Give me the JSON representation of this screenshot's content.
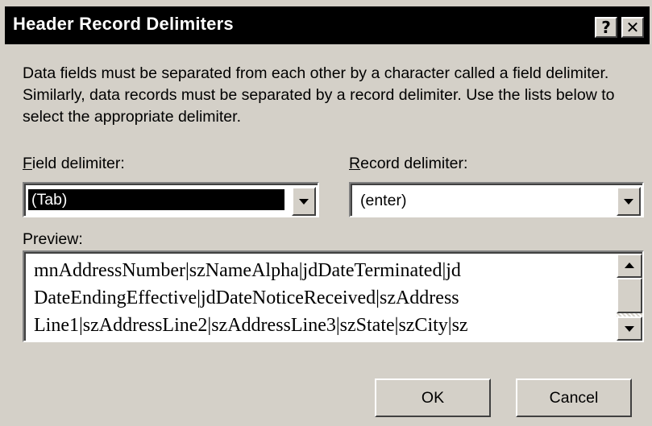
{
  "window": {
    "title": "Header Record Delimiters",
    "help_label": "?",
    "close_label": "✕"
  },
  "description": "Data fields must be separated from each other by a character called a field delimiter. Similarly, data records must be separated by a record delimiter. Use the lists below to select the appropriate delimiter.",
  "field_delimiter": {
    "label_first": "F",
    "label_rest": "ield delimiter:",
    "value": "(Tab)"
  },
  "record_delimiter": {
    "label_first": "R",
    "label_rest": "ecord delimiter:",
    "value": "(enter)"
  },
  "preview": {
    "label": "Preview:",
    "lines": [
      "mnAddressNumber|szNameAlpha|jdDateTerminated|jd",
      "DateEndingEffective|jdDateNoticeReceived|szAddress",
      "Line1|szAddressLine2|szAddressLine3|szState|szCity|sz"
    ]
  },
  "buttons": {
    "ok_label": "OK",
    "cancel_label": "Cancel"
  }
}
